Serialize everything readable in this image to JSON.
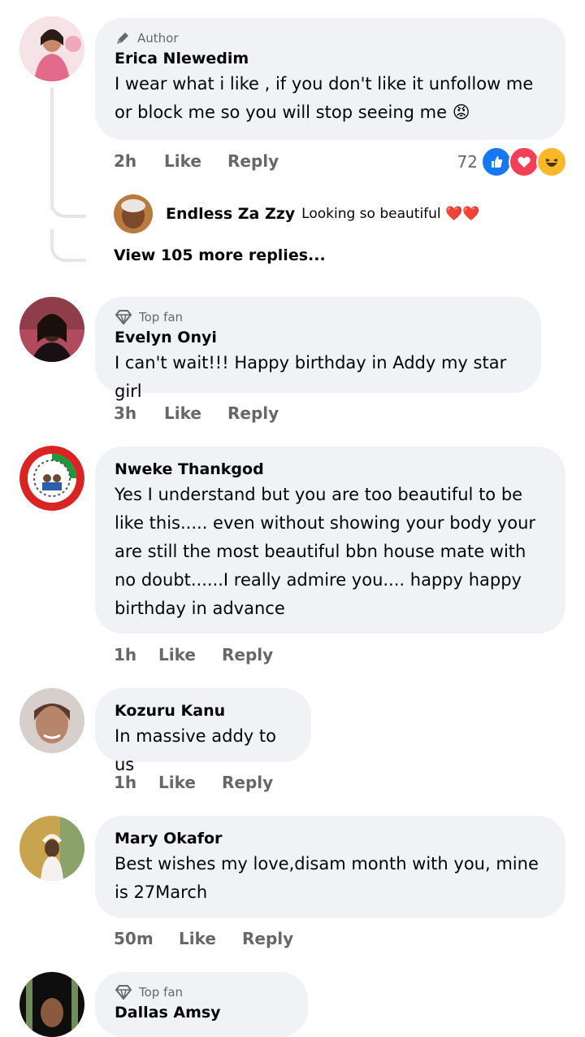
{
  "comments": [
    {
      "badge": "Author",
      "name": "Erica Nlewedim",
      "text": "I wear what i like ,  if you don't like it unfollow me or block me so you will stop seeing me 😡",
      "time": "2h",
      "like": "Like",
      "reply": "Reply",
      "reaction_count": "72",
      "reactions": [
        "like-reaction-icon",
        "love-reaction-icon",
        "haha-reaction-icon"
      ],
      "sub_reply": {
        "name": "Endless Za Zzy",
        "text": "Looking so beautiful ❤️❤️"
      },
      "more_replies": "View 105 more replies..."
    },
    {
      "badge": "Top fan",
      "name": "Evelyn Onyi",
      "text": "I can't wait!!! Happy birthday in Addy my star girl",
      "time": "3h",
      "like": "Like",
      "reply": "Reply"
    },
    {
      "name": "Nweke Thankgod",
      "text": "Yes I understand but you are too beautiful to be like this..... even without showing your body your are still the most beautiful bbn house mate with no doubt......I really admire you.... happy happy birthday in advance",
      "time": "1h",
      "like": "Like",
      "reply": "Reply"
    },
    {
      "name": "Kozuru Kanu",
      "text": "In massive addy to us",
      "time": "1h",
      "like": "Like",
      "reply": "Reply"
    },
    {
      "name": "Mary Okafor",
      "text": "Best wishes my love,disam month with you, mine is 27March",
      "time": "50m",
      "like": "Like",
      "reply": "Reply"
    },
    {
      "badge": "Top fan",
      "name": "Dallas Amsy"
    }
  ],
  "colors": {
    "bubble": "#f0f2f5",
    "muted": "#65676b",
    "thread": "#e4e6eb",
    "like_blue": "#1877f2",
    "love_red": "#f33e58",
    "haha_yellow": "#f7b928"
  }
}
